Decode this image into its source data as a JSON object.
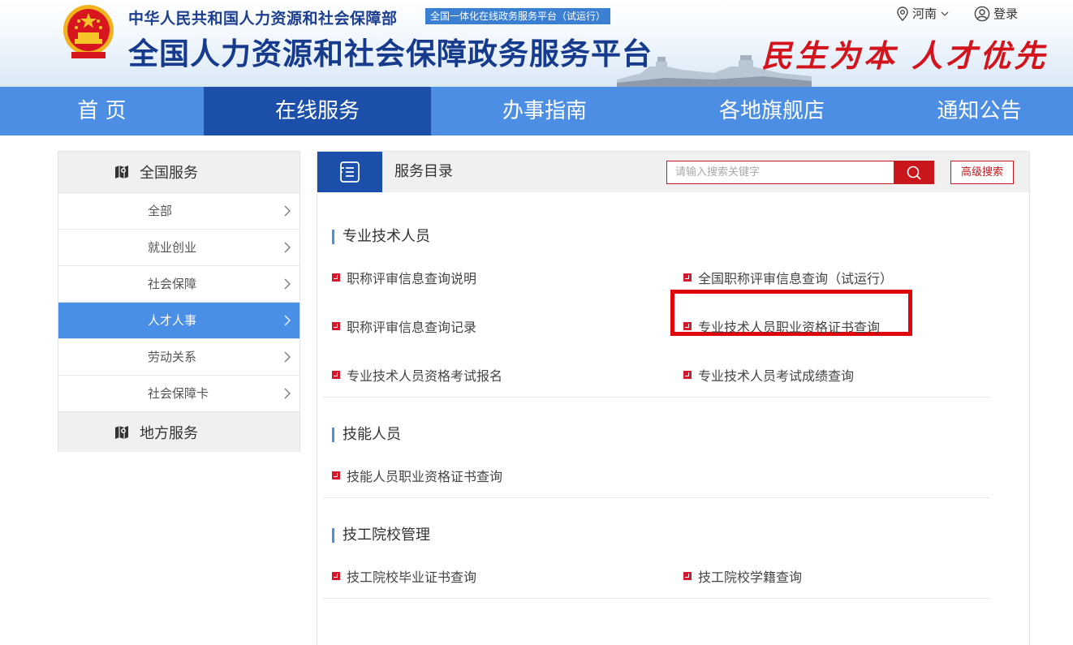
{
  "header": {
    "ministry": "中华人民共和国人力资源和社会保障部",
    "trial_badge": "全国一体化在线政务服务平台（试运行）",
    "platform_title": "全国人力资源和社会保障政务服务平台",
    "slogan": "民生为本 人才优先",
    "region": "河南",
    "login": "登录"
  },
  "nav": {
    "items": [
      {
        "label": "首 页"
      },
      {
        "label": "在线服务"
      },
      {
        "label": "办事指南"
      },
      {
        "label": "各地旗舰店"
      },
      {
        "label": "通知公告"
      }
    ],
    "active": "在线服务"
  },
  "sidebar": {
    "head": "全国服务",
    "items": [
      {
        "label": "全部"
      },
      {
        "label": "就业创业"
      },
      {
        "label": "社会保障"
      },
      {
        "label": "人才人事"
      },
      {
        "label": "劳动关系"
      },
      {
        "label": "社会保障卡"
      }
    ],
    "active": "人才人事",
    "foot": "地方服务"
  },
  "main": {
    "title": "服务目录",
    "search_placeholder": "请输入搜索关键字",
    "advanced_search": "高级搜索",
    "sections": [
      {
        "title": "专业技术人员",
        "services": [
          "职称评审信息查询说明",
          "全国职称评审信息查询（试运行）",
          "职称评审信息查询记录",
          "专业技术人员职业资格证书查询",
          "专业技术人员资格考试报名",
          "专业技术人员考试成绩查询"
        ]
      },
      {
        "title": "技能人员",
        "services": [
          "技能人员职业资格证书查询"
        ]
      },
      {
        "title": "技工院校管理",
        "services": [
          "技工院校毕业证书查询",
          "技工院校学籍查询"
        ]
      }
    ]
  },
  "colors": {
    "nav_bg": "#4b8ee4",
    "nav_active": "#1b4faa",
    "accent_red": "#c9161d",
    "title_blue": "#163a8c",
    "sidebar_active": "#4a8fe6"
  }
}
